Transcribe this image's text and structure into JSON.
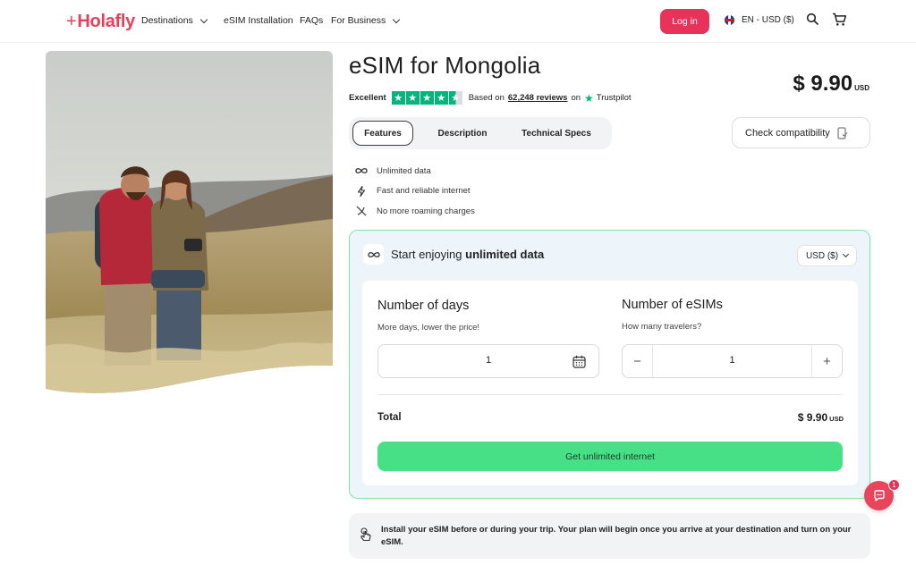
{
  "nav": {
    "logo": "Holafly",
    "items": [
      {
        "label": "Destinations",
        "dropdown": true
      },
      {
        "label": "eSIM Installation",
        "dropdown": false
      },
      {
        "label": "FAQs",
        "dropdown": false
      },
      {
        "label": "For Business",
        "dropdown": true
      }
    ],
    "login_label": "Log in",
    "language": "EN - USD ($)",
    "icons": [
      "search-icon",
      "cart-icon"
    ]
  },
  "product": {
    "title": "eSIM for Mongolia",
    "rating_word": "Excellent",
    "rating_stars": 4.5,
    "reviews_prefix": "Based on",
    "reviews_count": "62,248 reviews",
    "reviews_suffix": "on",
    "reviews_source": "Trustpilot",
    "price": "$ 9.90",
    "price_currency": "USD"
  },
  "tabs": [
    {
      "label": "Features",
      "active": true
    },
    {
      "label": "Description",
      "active": false
    },
    {
      "label": "Technical Specs",
      "active": false
    }
  ],
  "check_compatibility": "Check compatibility",
  "features": [
    {
      "icon": "infinity-icon",
      "label": "Unlimited data"
    },
    {
      "icon": "lightning-icon",
      "label": "Fast and reliable internet"
    },
    {
      "icon": "no-roaming-icon",
      "label": "No more roaming charges"
    }
  ],
  "plan": {
    "title_prefix": "Start enjoying",
    "title_bold": "unlimited data",
    "currency_select": "USD ($)",
    "days_label": "Number of days",
    "days_hint": "More days, lower the price!",
    "days_value": "1",
    "esims_label": "Number of eSIMs",
    "esims_hint": "How many travelers?",
    "esims_value": "1",
    "minus": "−",
    "plus": "+",
    "total_label": "Total",
    "total_value": "$ 9.90",
    "total_currency": "USD",
    "cta_label": "Get unlimited internet"
  },
  "note": "Install your eSIM before or during your trip. Your plan will begin once you arrive at your destination and turn on your eSIM.",
  "chat_badge": "1",
  "colors": {
    "brand": "#e8325a",
    "cta": "#47e087",
    "trustpilot": "#00b67a",
    "card_border": "#7ee6a6"
  }
}
